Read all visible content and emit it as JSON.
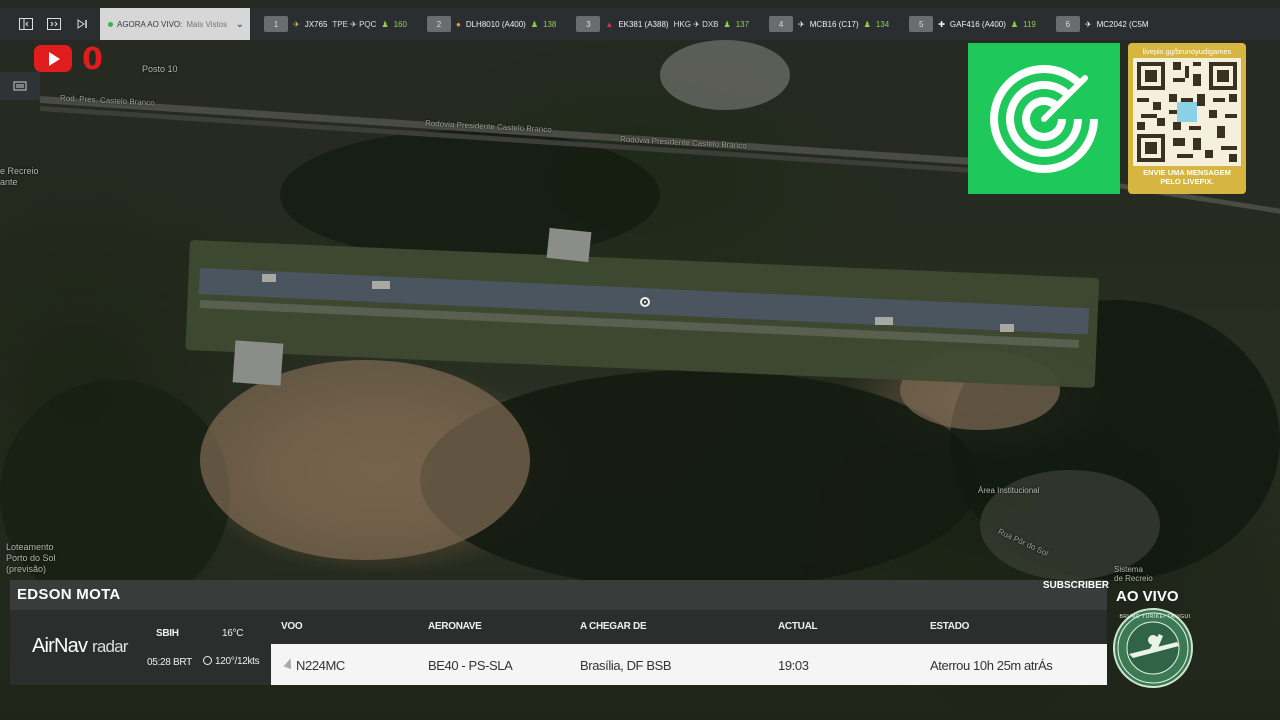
{
  "topbar": {
    "live_label": "AGORA AO VIVO:",
    "live_sub": "Mais Vistos",
    "flights": [
      {
        "rank": "1",
        "callsign": "JX765",
        "route": "TPE ✈ PQC",
        "count": "160",
        "icon_color": "#d9c04a"
      },
      {
        "rank": "2",
        "callsign": "DLH8010 (A400)",
        "route": "",
        "count": "138",
        "icon_color": "#e0a030"
      },
      {
        "rank": "3",
        "callsign": "EK381 (A388)",
        "route": "HKG ✈ DXB",
        "count": "137",
        "icon_color": "#d23a3a"
      },
      {
        "rank": "4",
        "callsign": "MCB16 (C17)",
        "route": "",
        "count": "134",
        "icon_color": "#cccccc"
      },
      {
        "rank": "5",
        "callsign": "GAF416 (A400)",
        "route": "",
        "count": "119",
        "icon_color": "#cccccc"
      },
      {
        "rank": "6",
        "callsign": "MC2042 (C5M",
        "route": "",
        "count": "",
        "icon_color": "#cccccc"
      }
    ]
  },
  "stream": {
    "youtube_count": "0"
  },
  "map_labels": {
    "posto": "Posto 10",
    "recreio": "e Recreio\nante",
    "loteamento": "Loteamento\nPorto do Sol\n(previsão)",
    "area": "Área Institucional",
    "sistema": "Sistema\nde Recreio",
    "rodovia1": "Rodovia Presidente Castelo Branco",
    "rodovia2": "Rodovia Presidente Castelo Branco",
    "rodovia3": "Rod. Pres. Castelo Branco",
    "rua": "Rua Pôr do Sol"
  },
  "qr": {
    "url": "livepix.gg/brunoyudigames",
    "message": "ENVIE UMA MENSAGEM PELO LIVEPIX."
  },
  "panel": {
    "name": "EDSON MOTA",
    "subscriber": "SUBSCRIBER",
    "brand": "AirNav",
    "brand_sub": "radar",
    "airport": "SBIH",
    "time": "05:28 BRT",
    "temp": "16°C",
    "wind": "120°/12kts",
    "headers": {
      "voo": "VOO",
      "aeronave": "AERONAVE",
      "chegar": "A CHEGAR DE",
      "actual": "ACTUAL",
      "estado": "ESTADO"
    },
    "row": {
      "voo": "N224MC",
      "aeronave": "BE40 - PS-SLA",
      "chegar": "Brasília, DF BSB",
      "actual": "19:03",
      "estado": "Aterrou 10h 25m atrÁs"
    }
  },
  "ao_vivo": "AO VIVO",
  "badge_text": "BRUNO YURIKEI TANIGUI"
}
